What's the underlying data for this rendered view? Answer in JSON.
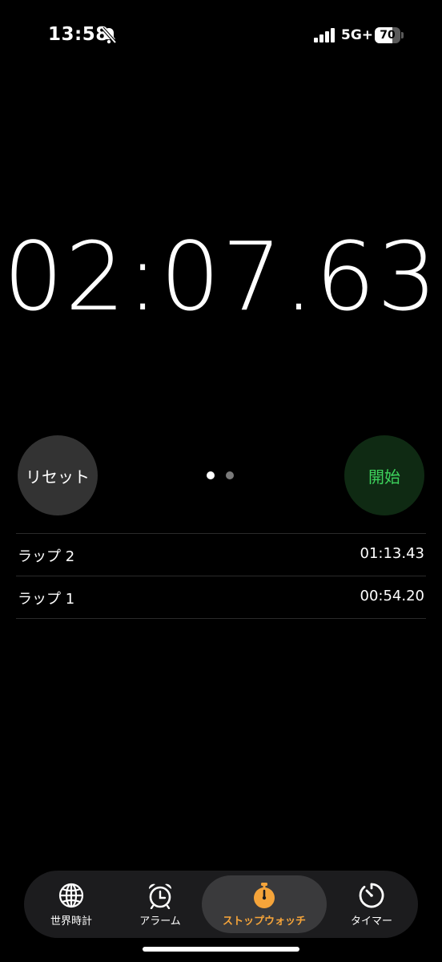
{
  "status_bar": {
    "time": "13:58",
    "network": "5G+",
    "battery_level": "70",
    "battery_fraction": 0.7,
    "icons": [
      "bell-slash-icon",
      "signal-bars-icon",
      "battery-icon"
    ]
  },
  "stopwatch": {
    "display": "02:07.63"
  },
  "controls": {
    "reset_label": "リセット",
    "start_label": "開始",
    "page_indicator": {
      "pages": 2,
      "current": 1
    }
  },
  "laps": [
    {
      "label": "ラップ 2",
      "time": "01:13.43"
    },
    {
      "label": "ラップ 1",
      "time": "00:54.20"
    }
  ],
  "tab_bar": {
    "tabs": [
      {
        "label": "世界時計",
        "icon": "globe-icon",
        "active": false
      },
      {
        "label": "アラーム",
        "icon": "alarm-clock-icon",
        "active": false
      },
      {
        "label": "ストップウォッチ",
        "icon": "stopwatch-icon",
        "active": true
      },
      {
        "label": "タイマー",
        "icon": "timer-icon",
        "active": false
      }
    ]
  },
  "colors": {
    "background": "#000000",
    "start_text": "#3dd35c",
    "start_bg": "#0f2a13",
    "reset_bg": "#333333",
    "active_tab": "#f5a43a"
  }
}
